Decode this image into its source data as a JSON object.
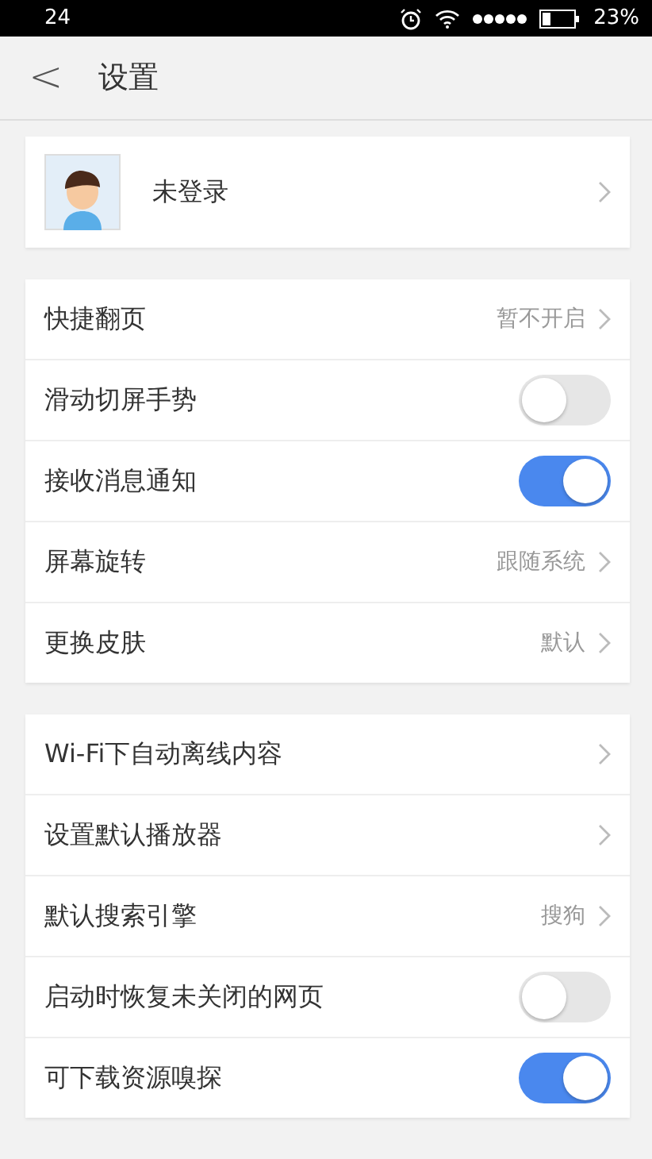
{
  "status_bar": {
    "time": "24",
    "battery": "23%"
  },
  "header": {
    "back": "<",
    "title": "设置"
  },
  "account": {
    "name": "未登录"
  },
  "groups": [
    {
      "items": [
        {
          "kind": "value",
          "label": "快捷翻页",
          "value": "暂不开启"
        },
        {
          "kind": "switch",
          "label": "滑动切屏手势",
          "on": false
        },
        {
          "kind": "switch",
          "label": "接收消息通知",
          "on": true
        },
        {
          "kind": "value",
          "label": "屏幕旋转",
          "value": "跟随系统"
        },
        {
          "kind": "value",
          "label": "更换皮肤",
          "value": "默认"
        }
      ]
    },
    {
      "items": [
        {
          "kind": "link",
          "label": "Wi-Fi下自动离线内容"
        },
        {
          "kind": "link",
          "label": "设置默认播放器"
        },
        {
          "kind": "value",
          "label": "默认搜索引擎",
          "value": "搜狗"
        },
        {
          "kind": "switch",
          "label": "启动时恢复未关闭的网页",
          "on": false
        },
        {
          "kind": "switch",
          "label": "可下载资源嗅探",
          "on": true
        }
      ]
    }
  ]
}
